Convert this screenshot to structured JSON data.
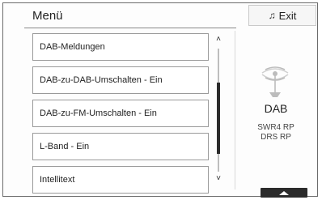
{
  "header": {
    "title": "Menü",
    "exit_label": "Exit",
    "exit_icon": "music-note-icon"
  },
  "menu": {
    "items": [
      {
        "label": "DAB-Meldungen"
      },
      {
        "label": "DAB-zu-DAB-Umschalten - Ein"
      },
      {
        "label": "DAB-zu-FM-Umschalten - Ein"
      },
      {
        "label": "L-Band - Ein"
      },
      {
        "label": "Intellitext"
      }
    ]
  },
  "scroll": {
    "up_glyph": "˄",
    "down_glyph": "˅"
  },
  "side": {
    "source": "DAB",
    "station_lines": [
      "SWR4 RP",
      "DRS RP"
    ],
    "icon": "dab-antenna-icon"
  },
  "footer": {
    "up_tab_icon": "chevron-up-icon"
  }
}
